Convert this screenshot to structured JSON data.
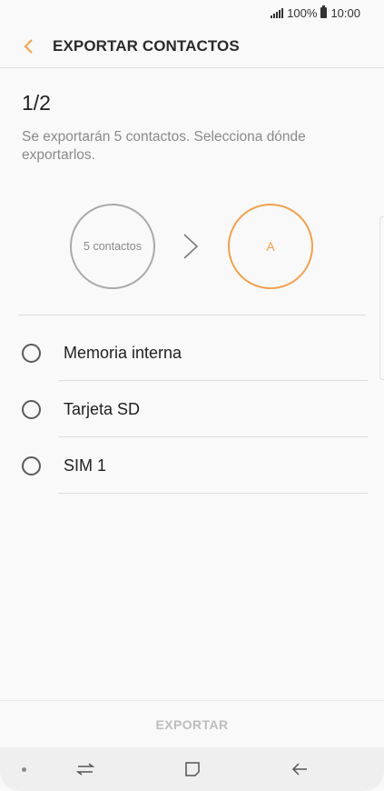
{
  "status_bar": {
    "battery": "100%",
    "time": "10:00"
  },
  "header": {
    "title": "EXPORTAR CONTACTOS"
  },
  "step": "1/2",
  "description": "Se exportarán 5 contactos. Selecciona dónde exportarlos.",
  "flow": {
    "source_label": "5 contactos",
    "target_label": "A"
  },
  "options": [
    {
      "label": "Memoria interna"
    },
    {
      "label": "Tarjeta SD"
    },
    {
      "label": "SIM 1"
    }
  ],
  "footer": {
    "export_label": "EXPORTAR"
  },
  "colors": {
    "accent": "#f0a04f",
    "disabled_text": "#bdbdbd",
    "background": "#f9f9f9"
  }
}
